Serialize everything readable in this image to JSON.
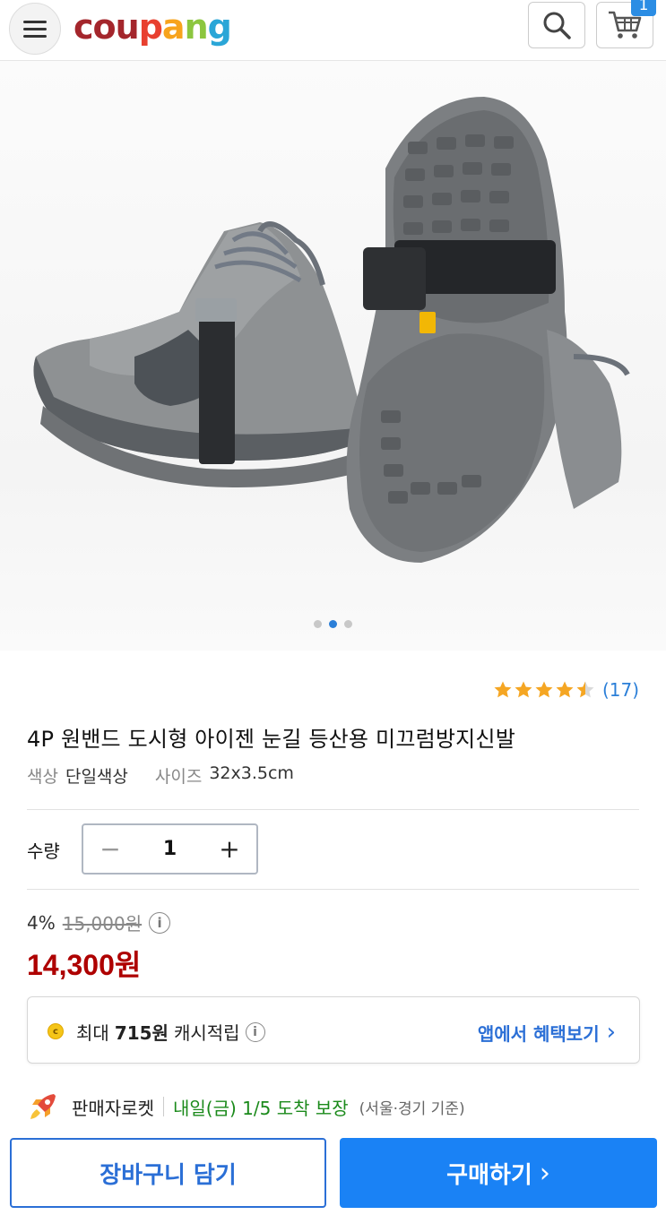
{
  "header": {
    "logo_letters": [
      {
        "ch": "c",
        "color": "#a4262c"
      },
      {
        "ch": "o",
        "color": "#a4262c"
      },
      {
        "ch": "u",
        "color": "#a4262c"
      },
      {
        "ch": "p",
        "color": "#e8402f"
      },
      {
        "ch": "a",
        "color": "#f7a31c"
      },
      {
        "ch": "n",
        "color": "#8cc63f"
      },
      {
        "ch": "g",
        "color": "#2aa6d7"
      }
    ],
    "cart_count": "1",
    "icons": {
      "menu": "hamburger-icon",
      "search": "search-icon",
      "cart": "cart-icon"
    }
  },
  "gallery": {
    "dot_count": 3,
    "active_index": 1
  },
  "product": {
    "rating": 4.5,
    "review_count": "(17)",
    "title": "4P 원밴드 도시형 아이젠 눈길 등산용 미끄럼방지신발",
    "color_label": "색상",
    "color_value": "단일색상",
    "size_label": "사이즈",
    "size_value": "32x3.5cm"
  },
  "quantity": {
    "label": "수량",
    "minus": "−",
    "value": "1",
    "plus": "+"
  },
  "pricing": {
    "discount_rate": "4%",
    "original_price": "15,000원",
    "info_glyph": "i",
    "price": "14,300원",
    "price_color": "#ae0000"
  },
  "cashback": {
    "coin_glyph": "c",
    "prefix": "최대",
    "amount": "715원",
    "suffix": "캐시적립",
    "info_glyph": "i",
    "app_benefit": "앱에서 혜택보기",
    "chevron": "›"
  },
  "delivery": {
    "seller": "판매자로켓",
    "arrival": "내일(금) 1/5 도착 보장",
    "region": "(서울·경기 기준)"
  },
  "actions": {
    "add_to_cart": "장바구니 담기",
    "buy_now": "구매하기",
    "buy_chevron": "›",
    "accent_color": "#1a82f5"
  }
}
